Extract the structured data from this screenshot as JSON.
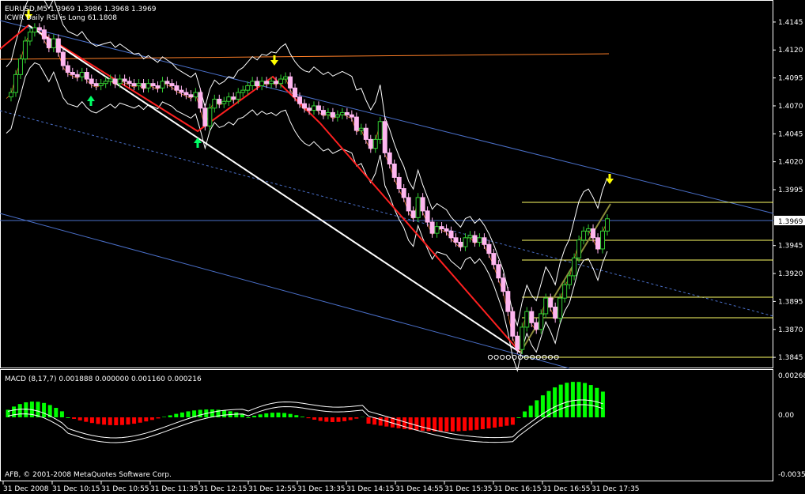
{
  "header": {
    "symbol_line": "EURUSD,M5  1.3969 1.3986 1.3968 1.3969",
    "indicator_line": "ICWR Daily RSI is Long 61.1808"
  },
  "macd_label": "MACD  (8,17,7) 0.001888 0.000000 0.001160 0.000216",
  "copyright": "AFB, © 2001-2008 MetaQuotes Software Corp.",
  "current_price": "1.3969",
  "colors": {
    "background": "#000000",
    "frame": "#ffffff",
    "bull_candle": "#32cd32",
    "bear_candle": "#ffb6f0",
    "zigzag_red": "#ff2020",
    "zigzag_white": "#ffffff",
    "channel_blue": "#4a6fc8",
    "bands": "#ffffff",
    "orange_line": "#ff7f27",
    "fib_yellow": "#ffff66",
    "macd_up": "#00ff00",
    "macd_down": "#ff0000"
  },
  "chart_data": [
    {
      "type": "candlestick",
      "y_tick_labels": [
        "1.4145",
        "1.4120",
        "1.4095",
        "1.4070",
        "1.4045",
        "1.4020",
        "1.3995",
        "1.3969",
        "1.3945",
        "1.3920",
        "1.3895",
        "1.3870",
        "1.3845"
      ],
      "ylim": [
        1.3838,
        1.4152
      ],
      "x_tick_labels": [
        "31 Dec 2008",
        "31 Dec 10:15",
        "31 Dec 10:55",
        "31 Dec 11:35",
        "31 Dec 12:15",
        "31 Dec 12:55",
        "31 Dec 13:35",
        "31 Dec 14:15",
        "31 Dec 14:55",
        "31 Dec 15:35",
        "31 Dec 16:15",
        "31 Dec 16:55",
        "31 Dec 17:35"
      ],
      "close": [
        1.4078,
        1.4082,
        1.4098,
        1.4112,
        1.4128,
        1.4136,
        1.414,
        1.4138,
        1.413,
        1.4122,
        1.413,
        1.4118,
        1.4106,
        1.41,
        1.4098,
        1.4096,
        1.41,
        1.4094,
        1.409,
        1.4088,
        1.409,
        1.4092,
        1.4094,
        1.409,
        1.4094,
        1.4092,
        1.409,
        1.4088,
        1.409,
        1.4086,
        1.409,
        1.4088,
        1.4086,
        1.4092,
        1.409,
        1.4088,
        1.4084,
        1.4082,
        1.408,
        1.4078,
        1.4082,
        1.4068,
        1.4052,
        1.4068,
        1.4076,
        1.4072,
        1.4074,
        1.4078,
        1.4076,
        1.4082,
        1.4084,
        1.4088,
        1.4092,
        1.4088,
        1.4092,
        1.409,
        1.4092,
        1.409,
        1.4094,
        1.4096,
        1.4086,
        1.4078,
        1.4072,
        1.4068,
        1.4066,
        1.407,
        1.4066,
        1.4062,
        1.4064,
        1.406,
        1.4062,
        1.4064,
        1.4062,
        1.406,
        1.4048,
        1.405,
        1.404,
        1.4032,
        1.404,
        1.4056,
        1.4028,
        1.4018,
        1.4006,
        1.3996,
        1.3988,
        1.3976,
        1.397,
        1.3988,
        1.3976,
        1.3966,
        1.3956,
        1.3962,
        1.396,
        1.3958,
        1.3952,
        1.3948,
        1.3944,
        1.3952,
        1.3954,
        1.3948,
        1.3952,
        1.3946,
        1.3938,
        1.3928,
        1.3916,
        1.3904,
        1.3886,
        1.3864,
        1.3852,
        1.3872,
        1.3886,
        1.3876,
        1.387,
        1.3884,
        1.3898,
        1.389,
        1.388,
        1.3898,
        1.391,
        1.3918,
        1.3934,
        1.395,
        1.3958,
        1.396,
        1.3952,
        1.3942,
        1.3958,
        1.3969
      ],
      "series": [
        {
          "name": "MACD",
          "axis_labels": [
            "0.00268",
            "0.00",
            "-0.00353"
          ]
        }
      ]
    }
  ]
}
